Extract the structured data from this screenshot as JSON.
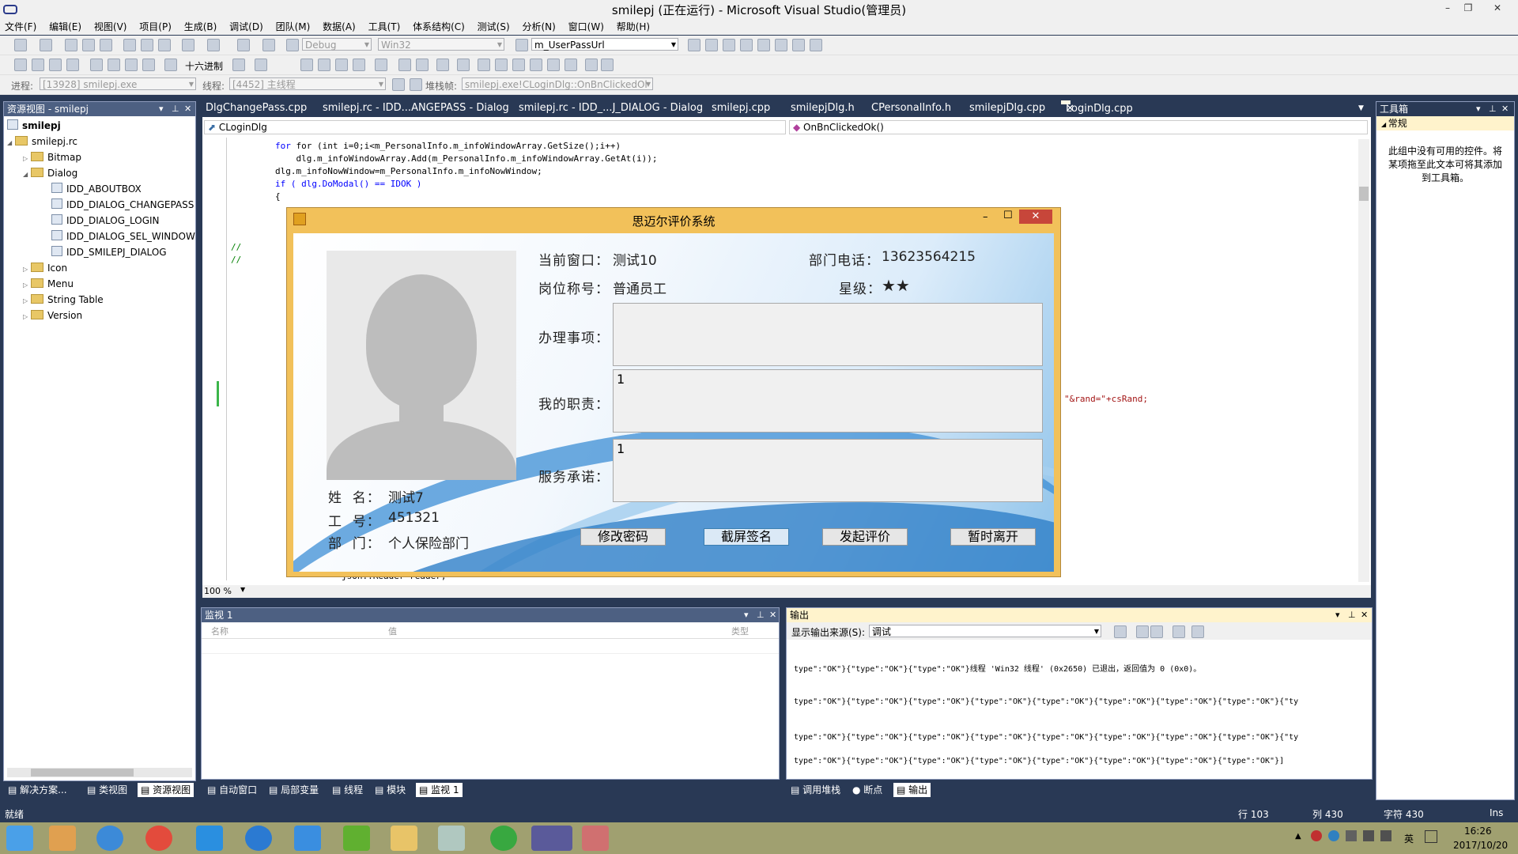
{
  "window": {
    "title": "smilepj (正在运行) - Microsoft Visual Studio(管理员)",
    "minimize": "–",
    "restore": "❐",
    "close": "✕"
  },
  "menu": [
    "文件(F)",
    "编辑(E)",
    "视图(V)",
    "项目(P)",
    "生成(B)",
    "调试(D)",
    "团队(M)",
    "数据(A)",
    "工具(T)",
    "体系结构(C)",
    "测试(S)",
    "分析(N)",
    "窗口(W)",
    "帮助(H)"
  ],
  "toolbar1": {
    "config": "Debug",
    "platform": "Win32",
    "find_combo": "m_UserPassUrl"
  },
  "toolbar2": {
    "hex_label": "十六进制"
  },
  "toolbar3": {
    "process_label": "进程:",
    "process": "[13928] smilepj.exe",
    "thread_label": "线程:",
    "thread": "[4452] 主线程",
    "stack_label": "堆栈帧:",
    "stack": "smilepj.exe!CLoginDlg::OnBnClickedOl"
  },
  "resource_view": {
    "title": "资源视图 - smilepj",
    "items": [
      {
        "label": "smilepj",
        "level": 0,
        "kind": "project"
      },
      {
        "label": "smilepj.rc",
        "level": 1,
        "kind": "folder"
      },
      {
        "label": "Bitmap",
        "level": 2,
        "kind": "folder"
      },
      {
        "label": "Dialog",
        "level": 2,
        "kind": "folder"
      },
      {
        "label": "IDD_ABOUTBOX",
        "level": 3,
        "kind": "dialog"
      },
      {
        "label": "IDD_DIALOG_CHANGEPASS",
        "level": 3,
        "kind": "dialog"
      },
      {
        "label": "IDD_DIALOG_LOGIN",
        "level": 3,
        "kind": "dialog"
      },
      {
        "label": "IDD_DIALOG_SEL_WINDOW",
        "level": 3,
        "kind": "dialog"
      },
      {
        "label": "IDD_SMILEPJ_DIALOG",
        "level": 3,
        "kind": "dialog"
      },
      {
        "label": "Icon",
        "level": 2,
        "kind": "folder"
      },
      {
        "label": "Menu",
        "level": 2,
        "kind": "folder"
      },
      {
        "label": "String Table",
        "level": 2,
        "kind": "folder"
      },
      {
        "label": "Version",
        "level": 2,
        "kind": "folder"
      }
    ],
    "tabs": [
      "解决方案...",
      "类视图",
      "资源视图"
    ]
  },
  "doc_tabs": [
    "DlgChangePass.cpp",
    "smilepj.rc - IDD...ANGEPASS - Dialog",
    "smilepj.rc - IDD_...J_DIALOG - Dialog",
    "smilepj.cpp",
    "smilepjDlg.h",
    "CPersonalInfo.h",
    "smilepjDlg.cpp",
    "LoginDlg.cpp"
  ],
  "editor": {
    "class_combo": "CLoginDlg",
    "method_combo": "OnBnClickedOk()",
    "code": [
      "for (int i=0;i<m_PersonalInfo.m_infoWindowArray.GetSize();i++)",
      "    dlg.m_infoWindowArray.Add(m_PersonalInfo.m_infoWindowArray.GetAt(i));",
      "dlg.m_infoNowWindow=m_PersonalInfo.m_infoNowWindow;",
      "if ( dlg.DoModal() == IDOK )",
      "{"
    ],
    "comment1": "//",
    "comment2": "//",
    "partial_right": "\"&rand=\"+csRand;",
    "partial_bottom": "json::Reader reader;",
    "zoom": "100 %"
  },
  "dialog": {
    "title": "思迈尔评价系统",
    "current_window_label": "当前窗口：",
    "current_window": "测试10",
    "dept_phone_label": "部门电话：",
    "dept_phone": "13623564215",
    "post_label": "岗位称号：",
    "post": "普通员工",
    "star_label": "星级：",
    "stars": "★★",
    "matters_label": "办理事项：",
    "matters_value": "",
    "duty_label": "我的职责：",
    "duty_value": "1",
    "promise_label": "服务承诺：",
    "promise_value": "1",
    "name_label": "姓  名：",
    "name": "测试7",
    "id_label": "工  号：",
    "id": "451321",
    "dept_label": "部  门：",
    "dept": "个人保险部门",
    "buttons": [
      "修改密码",
      "截屏签名",
      "发起评价",
      "暂时离开"
    ]
  },
  "toolbox": {
    "title": "工具箱",
    "group": "常规",
    "empty_text": "此组中没有可用的控件。将某项拖至此文本可将其添加到工具箱。"
  },
  "watch": {
    "title": "监视 1",
    "columns": [
      "名称",
      "值",
      "类型"
    ],
    "tabs": [
      "自动窗口",
      "局部变量",
      "线程",
      "模块",
      "监视 1"
    ]
  },
  "output": {
    "title": "输出",
    "source_label": "显示输出来源(S):",
    "source": "调试",
    "lines": [
      "type\":\"OK\"}{\"type\":\"OK\"}{\"type\":\"OK\"}线程 'Win32 线程' (0x2650) 已退出，返回值为 0 (0x0)。",
      "type\":\"OK\"}{\"type\":\"OK\"}{\"type\":\"OK\"}{\"type\":\"OK\"}{\"type\":\"OK\"}{\"type\":\"OK\"}{\"type\":\"OK\"}{\"type\":\"OK\"}{\"ty",
      "type\":\"OK\"}{\"type\":\"OK\"}{\"type\":\"OK\"}{\"type\":\"OK\"}{\"type\":\"OK\"}{\"type\":\"OK\"}{\"type\":\"OK\"}{\"type\":\"OK\"}{\"ty",
      "type\":\"OK\"}{\"type\":\"OK\"}{\"type\":\"OK\"}{\"type\":\"OK\"}{\"type\":\"OK\"}{\"type\":\"OK\"}{\"type\":\"OK\"}{\"type\":\"OK\"}]"
    ],
    "tabs": [
      "调用堆栈",
      "断点",
      "输出"
    ]
  },
  "status": {
    "ready": "就绪",
    "line": "行 103",
    "col": "列 430",
    "char": "字符 430",
    "ins": "Ins"
  },
  "taskbar": {
    "time": "16:26",
    "date": "2017/10/20",
    "ime": "英"
  }
}
